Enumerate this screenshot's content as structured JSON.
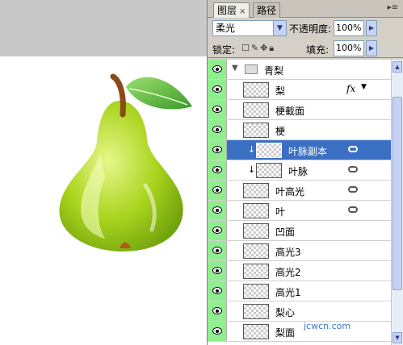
{
  "tabs": [
    {
      "label": "图层",
      "close": "×"
    },
    {
      "label": "路径"
    }
  ],
  "panel_menu_icon": "panel-menu-icon",
  "blend_mode": "柔光",
  "opacity_label": "不透明度:",
  "opacity_value": "100%",
  "lock_label": "锁定:",
  "lock_icons": "lock-transparency, lock-image, lock-position, lock-all",
  "fill_label": "填充:",
  "fill_value": "100%",
  "layers": [
    {
      "name": "青梨",
      "type": "group"
    },
    {
      "name": "梨",
      "fx": "fx"
    },
    {
      "name": "梗截面"
    },
    {
      "name": "梗"
    },
    {
      "name": "叶脉副本",
      "selected": true,
      "linked": true
    },
    {
      "name": "叶脉",
      "linked": true
    },
    {
      "name": "叶高光",
      "linked": true
    },
    {
      "name": "叶",
      "linked": true
    },
    {
      "name": "凹面"
    },
    {
      "name": "高光3"
    },
    {
      "name": "高光2"
    },
    {
      "name": "高光1"
    },
    {
      "name": "梨心"
    },
    {
      "name": "梨面"
    }
  ],
  "watermark": "jcwcn.com"
}
